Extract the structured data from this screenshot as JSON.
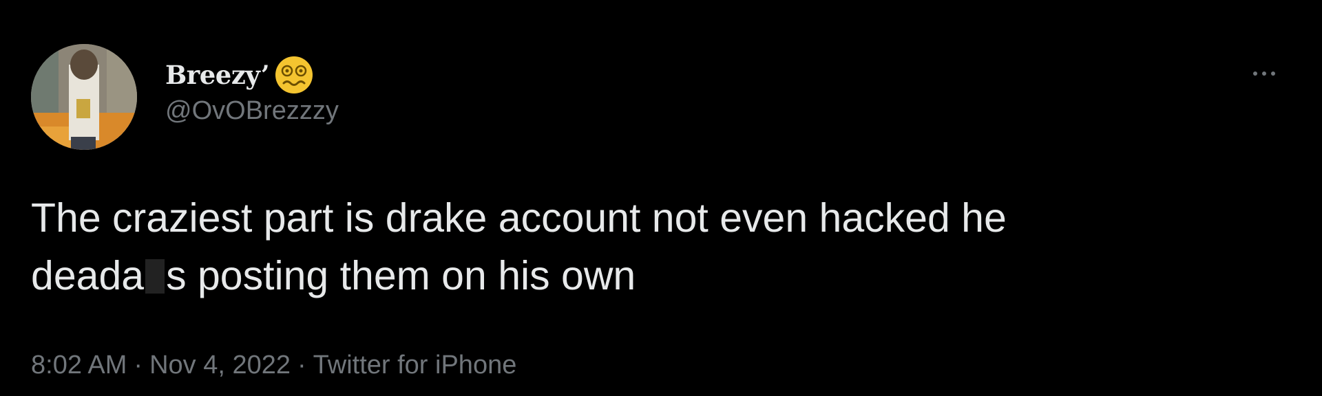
{
  "author": {
    "display_name": "Breezy’",
    "handle": "@OvOBrezzzy",
    "emoji_icon": "woozy-face-icon",
    "avatar_icon": "user-avatar-photo"
  },
  "tweet": {
    "line1": "The craziest part is drake account not even hacked he",
    "line2_part1": "deada",
    "line2_part2": "s posting them on his own"
  },
  "meta": {
    "time": "8:02 AM",
    "date": "Nov 4, 2022",
    "source": "Twitter for iPhone",
    "separator": "·"
  },
  "actions": {
    "more_icon": "more-horizontal-icon"
  },
  "colors": {
    "background": "#000000",
    "primary_text": "#e7e9ea",
    "secondary_text": "#71767b",
    "emoji_yellow": "#f4c430"
  }
}
